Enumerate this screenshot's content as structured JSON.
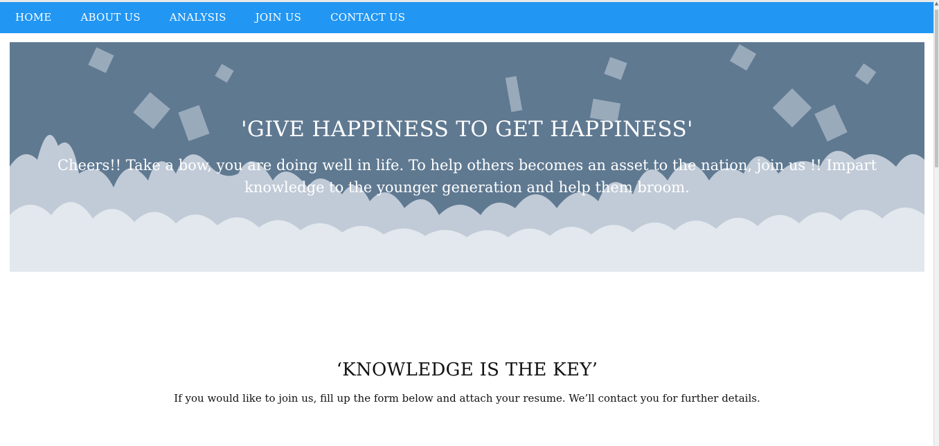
{
  "nav": {
    "items": [
      "HOME",
      "ABOUT US",
      "ANALYSIS",
      "JOIN US",
      "CONTACT US"
    ]
  },
  "hero": {
    "title": "'GIVE HAPPINESS TO GET HAPPINESS'",
    "text": "Cheers!! Take a bow, you are doing well in life. To help others becomes an asset to the nation, join us !! Impart knowledge to the younger generation and help them broom.",
    "background_color": "#5f7991"
  },
  "section": {
    "title": "‘KNOWLEDGE IS THE KEY’",
    "text": "If you would like to join us, fill up the form below and attach your resume. We’ll contact you for further details."
  },
  "colors": {
    "navbar": "#2196f3",
    "nav_text": "#ffffff",
    "silhouette": "#dfe5ec"
  }
}
